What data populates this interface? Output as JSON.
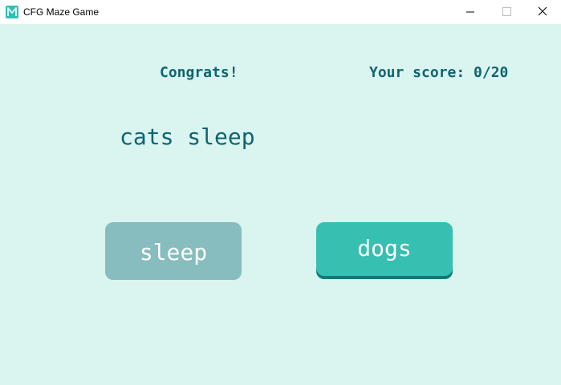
{
  "window": {
    "title": "CFG Maze Game",
    "app_icon": "maze-logo-icon",
    "controls": [
      "minimize-icon",
      "maximize-icon",
      "close-icon"
    ]
  },
  "game": {
    "message": "Congrats!",
    "score_text": "Your score: 0/20",
    "sentence": "cats sleep"
  },
  "choices": [
    {
      "label": "sleep",
      "state": "disabled"
    },
    {
      "label": "dogs",
      "state": "active"
    }
  ],
  "colors": {
    "background": "#daf4ef",
    "text": "#0f6470",
    "button_disabled": "#87bdbf",
    "button_active": "#37bfb2",
    "button_active_shadow": "#0f7a78",
    "button_text": "#ffffff"
  }
}
